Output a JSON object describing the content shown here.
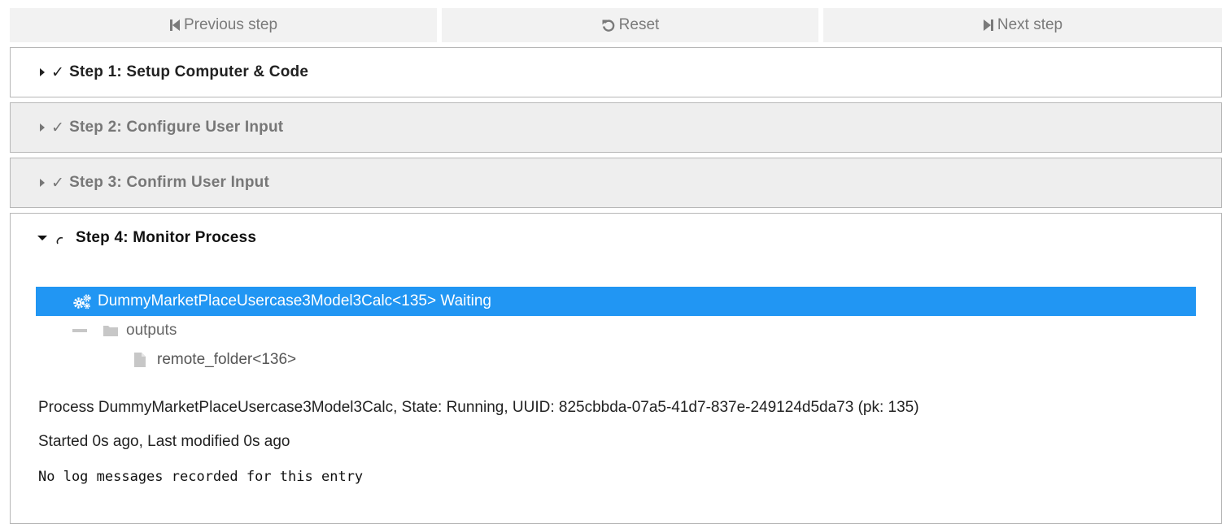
{
  "nav": {
    "previous_label": "Previous step",
    "reset_label": "Reset",
    "next_label": "Next step"
  },
  "steps": [
    {
      "status": "✓",
      "label": "Step 1: Setup Computer & Code"
    },
    {
      "status": "✓",
      "label": "Step 2: Configure User Input"
    },
    {
      "status": "✓",
      "label": "Step 3: Confirm User Input"
    },
    {
      "status": "running",
      "label": "Step 4: Monitor Process"
    }
  ],
  "tree": {
    "root_label": "DummyMarketPlaceUsercase3Model3Calc<135> Waiting",
    "root_icon": "gears-icon",
    "folder_label": "outputs",
    "folder_icon": "folder-icon",
    "file_label": "remote_folder<136>",
    "file_icon": "file-icon"
  },
  "process_info": {
    "summary": "Process DummyMarketPlaceUsercase3Model3Calc, State: Running, UUID: 825cbbda-07a5-41d7-837e-249124d5da73 (pk: 135)",
    "timing": "Started 0s ago, Last modified 0s ago",
    "log": "No log messages recorded for this entry"
  },
  "colors": {
    "selected_row": "#2196f3",
    "button_bg": "#f2f2f2",
    "collapsed_panel_bg": "#eeeeee"
  }
}
